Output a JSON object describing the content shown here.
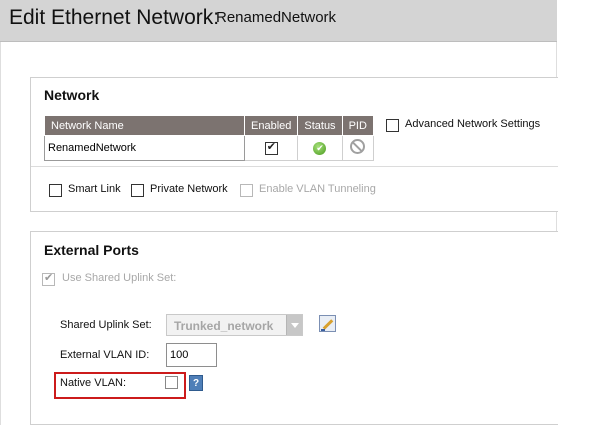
{
  "header": {
    "title": "Edit Ethernet Network:",
    "network_name": "RenamedNetwork"
  },
  "network": {
    "title": "Network",
    "columns": [
      "Network Name",
      "Enabled",
      "Status",
      "PID"
    ],
    "name_value": "RenamedNetwork",
    "enabled": true,
    "status_icon": "status-ok-icon",
    "pid_icon": "pid-disabled-icon",
    "advanced_label": "Advanced Network Settings",
    "smart_link_label": "Smart Link",
    "private_network_label": "Private Network",
    "vlan_tunneling_label": "Enable VLAN Tunneling"
  },
  "external_ports": {
    "title": "External Ports",
    "use_shared_label": "Use Shared Uplink Set:",
    "shared_uplink_label": "Shared Uplink Set:",
    "shared_uplink_value": "Trunked_network",
    "external_vlan_label": "External VLAN ID:",
    "external_vlan_value": "100",
    "native_vlan_label": "Native VLAN:",
    "help_label": "?"
  },
  "colors": {
    "header_bg": "#d4d4d4",
    "table_header_bg": "#7c7370",
    "highlight": "#cc1b1b",
    "help_button": "#4f7fb8"
  }
}
